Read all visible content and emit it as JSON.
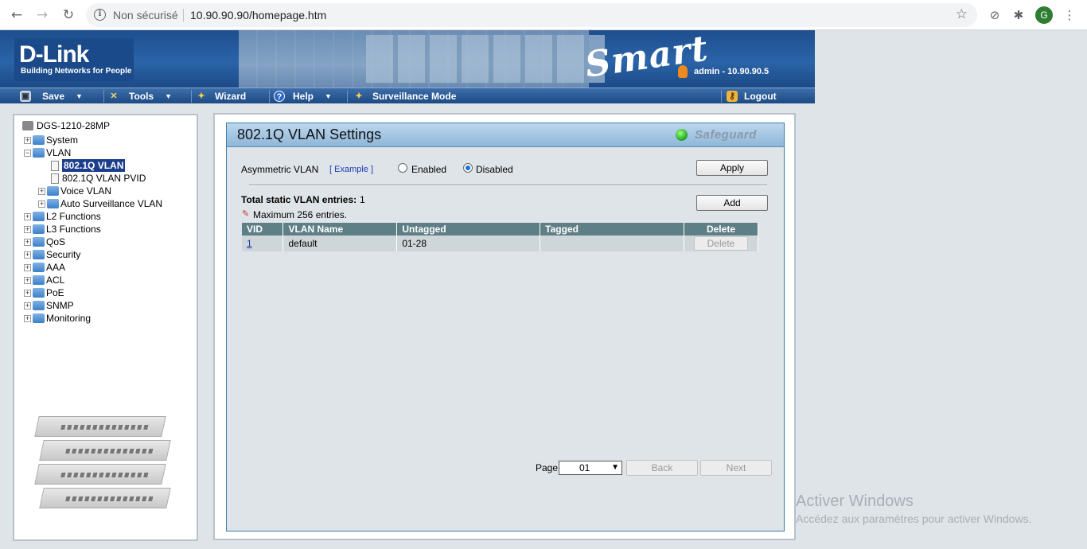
{
  "browser": {
    "not_secure": "Non sécurisé",
    "url": "10.90.90.90/homepage.htm",
    "profile_initial": "G"
  },
  "brand": {
    "logo": "D-Link",
    "tagline": "Building Networks for People",
    "product_line": "Smart",
    "user": "admin - 10.90.90.5"
  },
  "menu": {
    "save": "Save",
    "tools": "Tools",
    "wizard": "Wizard",
    "help": "Help",
    "surveillance": "Surveillance Mode",
    "logout": "Logout"
  },
  "tree": {
    "root": "DGS-1210-28MP",
    "items": [
      {
        "label": "System"
      },
      {
        "label": "VLAN"
      },
      {
        "label": "802.1Q VLAN"
      },
      {
        "label": "802.1Q VLAN PVID"
      },
      {
        "label": "Voice VLAN"
      },
      {
        "label": "Auto Surveillance VLAN"
      },
      {
        "label": "L2 Functions"
      },
      {
        "label": "L3 Functions"
      },
      {
        "label": "QoS"
      },
      {
        "label": "Security"
      },
      {
        "label": "AAA"
      },
      {
        "label": "ACL"
      },
      {
        "label": "PoE"
      },
      {
        "label": "SNMP"
      },
      {
        "label": "Monitoring"
      }
    ]
  },
  "page": {
    "title": "802.1Q VLAN Settings",
    "safeguard": "Safeguard",
    "asym_label": "Asymmetric VLAN",
    "example": "[ Example ]",
    "enabled": "Enabled",
    "disabled": "Disabled",
    "asym_value": "Disabled",
    "apply": "Apply",
    "total_label": "Total static VLAN entries:",
    "total_value": "1",
    "add": "Add",
    "max_note": "Maximum 256 entries.",
    "columns": [
      "VID",
      "VLAN Name",
      "Untagged",
      "Tagged",
      "Delete"
    ],
    "rows": [
      {
        "vid": "1",
        "name": "default",
        "untagged": "01-28",
        "tagged": "",
        "delete": "Delete"
      }
    ],
    "page_label": "Page",
    "page_value": "01",
    "back": "Back",
    "next": "Next"
  },
  "watermark": {
    "line1": "Activer Windows",
    "line2": "Accédez aux paramètres pour activer Windows."
  }
}
